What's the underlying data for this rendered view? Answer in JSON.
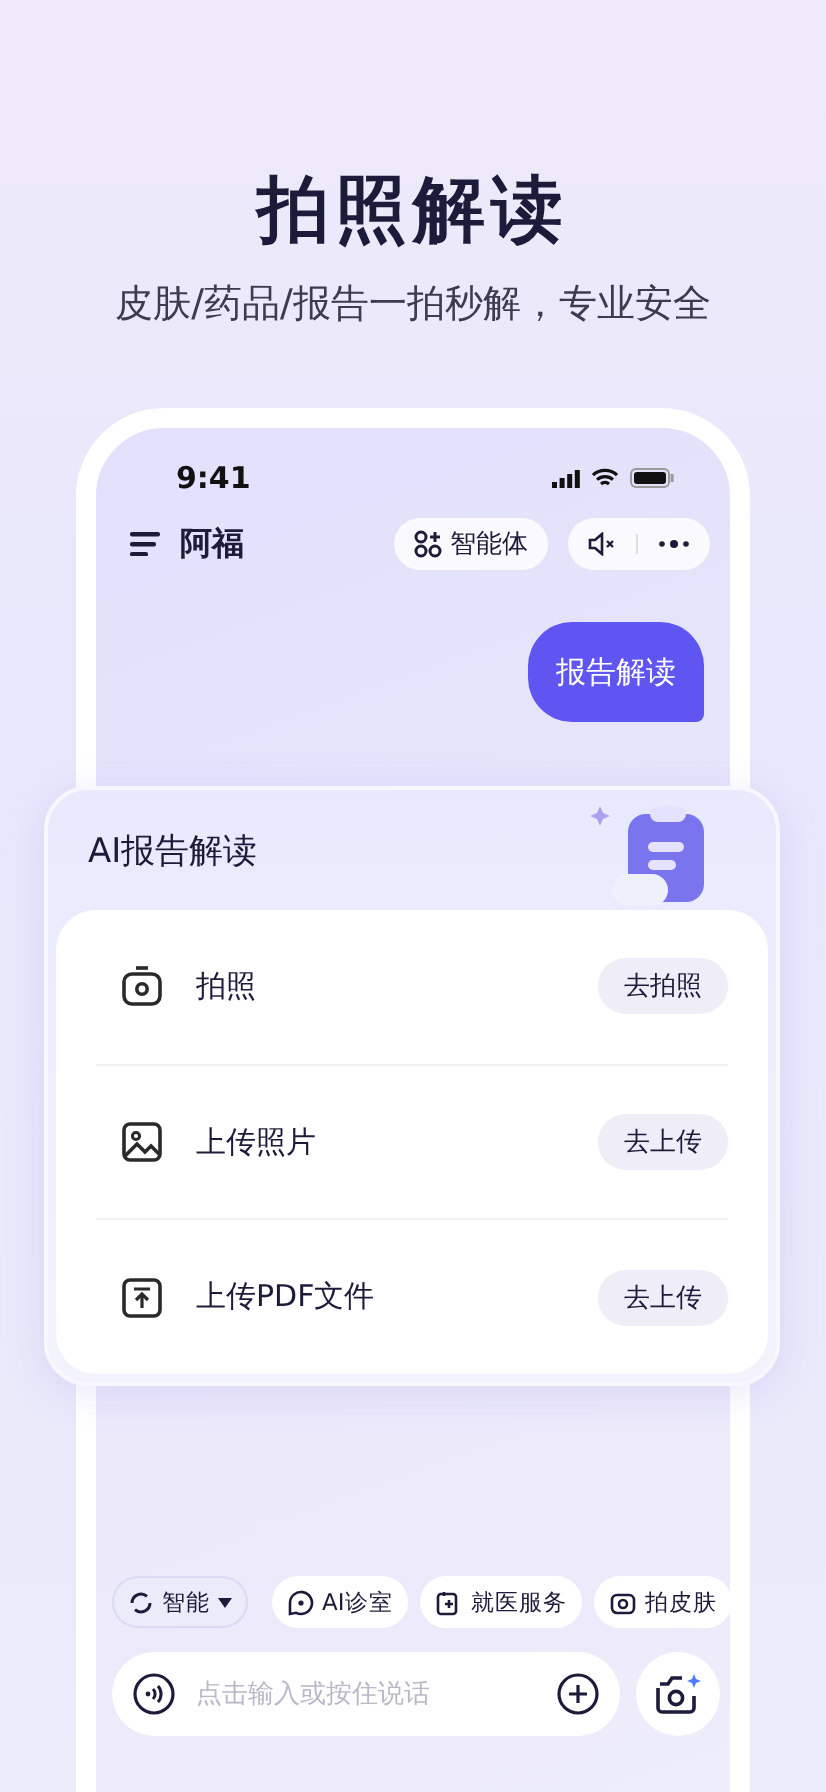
{
  "headline": "拍照解读",
  "subtitle": "皮肤/药品/报告一拍秒解，专业安全",
  "status_bar": {
    "time": "9:41"
  },
  "header": {
    "title": "阿福",
    "agent_button": "智能体"
  },
  "chat": {
    "bubble": "报告解读"
  },
  "report_card": {
    "title": "AI报告解读",
    "options": [
      {
        "kind": "camera",
        "label": "拍照",
        "action": "去拍照"
      },
      {
        "kind": "image",
        "label": "上传照片",
        "action": "去上传"
      },
      {
        "kind": "upload",
        "label": "上传PDF文件",
        "action": "去上传"
      }
    ]
  },
  "chips": [
    {
      "kind": "mode",
      "label": "智能"
    },
    {
      "kind": "clinic",
      "label": "AI诊室"
    },
    {
      "kind": "service",
      "label": "就医服务"
    },
    {
      "kind": "skin",
      "label": "拍皮肤"
    }
  ],
  "input": {
    "placeholder": "点击输入或按住说话"
  }
}
